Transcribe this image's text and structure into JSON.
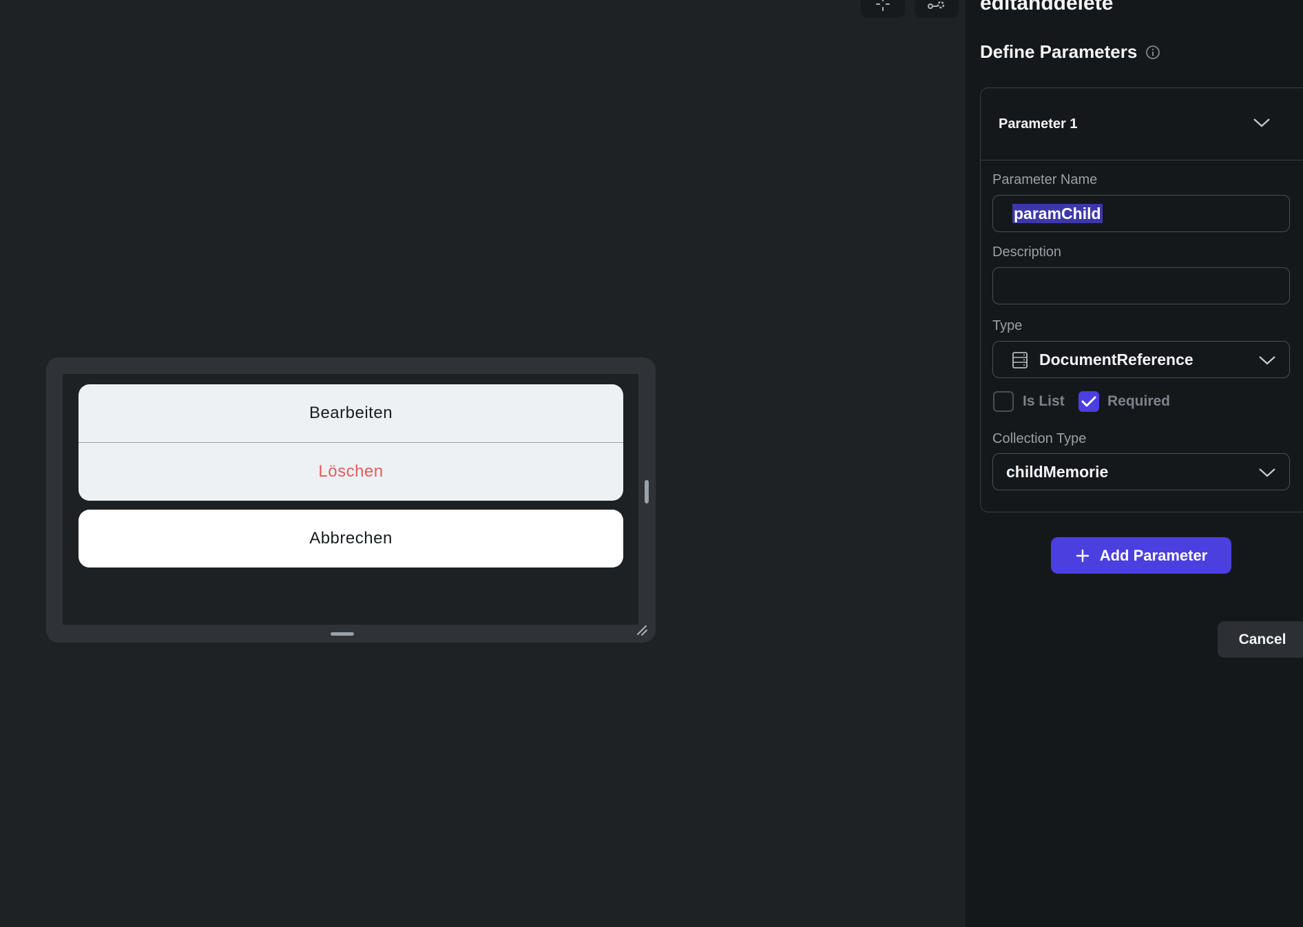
{
  "toolbar": {
    "icons": [
      "sparkle-icon",
      "flow-settings-icon"
    ]
  },
  "preview": {
    "actions": [
      "Bearbeiten",
      "Löschen"
    ],
    "cancel_label": "Abbrechen",
    "colors": {
      "destructive": "#e25c5c",
      "sheet_bg": "#eef1f4"
    }
  },
  "panel": {
    "title": "editanddelete",
    "section_title": "Define Parameters",
    "parameter": {
      "header": "Parameter 1",
      "name_label": "Parameter Name",
      "name_value": "paramChild",
      "description_label": "Description",
      "description_value": "",
      "type_label": "Type",
      "type_value": "DocumentReference",
      "is_list_label": "Is List",
      "is_list_checked": false,
      "required_label": "Required",
      "required_checked": true,
      "collection_label": "Collection Type",
      "collection_value": "childMemorie"
    },
    "add_button": "Add Parameter",
    "cancel_button": "Cancel",
    "colors": {
      "accent": "#4b3fe0"
    }
  }
}
